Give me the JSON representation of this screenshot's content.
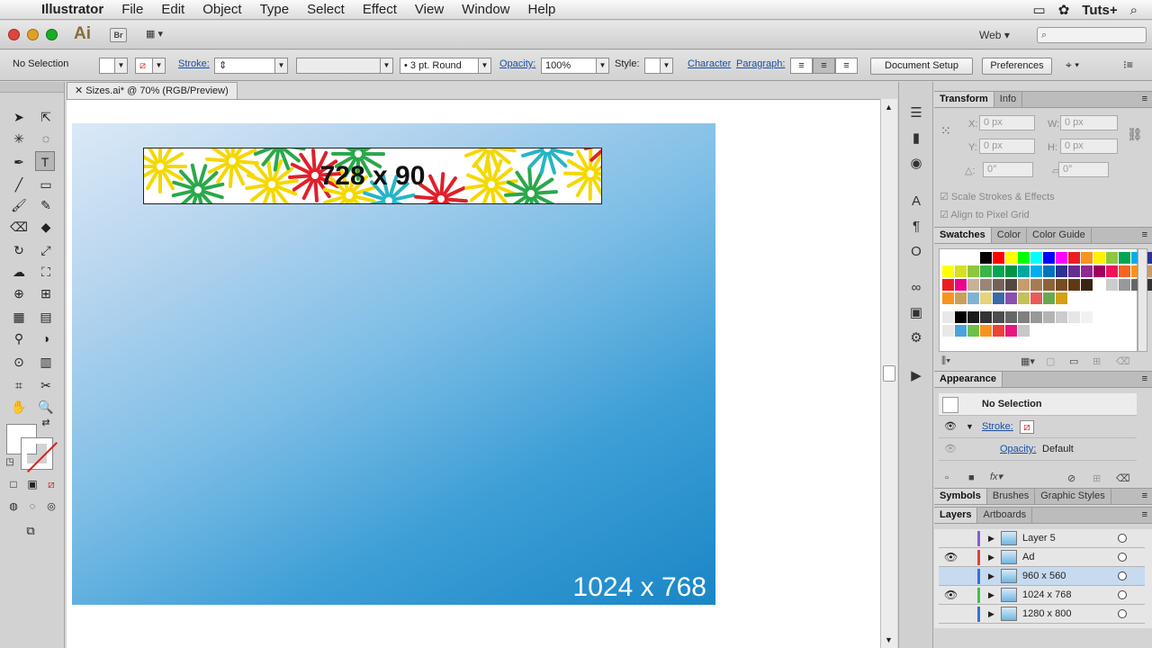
{
  "menubar": {
    "app_name": "Illustrator",
    "items": [
      "File",
      "Edit",
      "Object",
      "Type",
      "Select",
      "Effect",
      "View",
      "Window",
      "Help"
    ],
    "right_label": "Tuts+"
  },
  "appbar": {
    "logo": "Ai",
    "bridge_label": "Br",
    "workspace": "Web",
    "workspace_arrow": "▾"
  },
  "control": {
    "selection": "No Selection",
    "stroke_label": "Stroke:",
    "brush": "3 pt. Round",
    "opacity_label": "Opacity:",
    "opacity_value": "100%",
    "style_label": "Style:",
    "character_link": "Character",
    "paragraph_link": "Paragraph:",
    "document_setup": "Document Setup",
    "preferences": "Preferences"
  },
  "document": {
    "tab_title": "Sizes.ai* @ 70% (RGB/Preview)",
    "banner_label": "728 x 90",
    "artboard_label": "1024 x 768"
  },
  "transform_panel": {
    "tabs": [
      "Transform",
      "Info"
    ],
    "x_label": "X:",
    "x_value": "0 px",
    "y_label": "Y:",
    "y_value": "0 px",
    "w_label": "W:",
    "w_value": "0 px",
    "h_label": "H:",
    "h_value": "0 px",
    "angle_value": "0°",
    "shear_value": "0°",
    "scale_strokes": "Scale Strokes & Effects",
    "align_pixel": "Align to Pixel Grid"
  },
  "swatches_panel": {
    "tabs": [
      "Swatches",
      "Color",
      "Color Guide"
    ]
  },
  "appearance_panel": {
    "title": "Appearance",
    "no_selection": "No Selection",
    "stroke_label": "Stroke:",
    "opacity_label": "Opacity:",
    "opacity_value": "Default"
  },
  "symbols_panel": {
    "tabs": [
      "Symbols",
      "Brushes",
      "Graphic Styles"
    ]
  },
  "layers_panel": {
    "tabs": [
      "Layers",
      "Artboards"
    ],
    "layers": [
      {
        "name": "Layer 5",
        "color": "#8a5cd6",
        "visible": false
      },
      {
        "name": "Ad",
        "color": "#e04040",
        "visible": true
      },
      {
        "name": "960 x 560",
        "color": "#3a6fd8",
        "visible": false
      },
      {
        "name": "1024 x 768",
        "color": "#3ec24a",
        "visible": true
      },
      {
        "name": "1280 x 800",
        "color": "#3a6fd8",
        "visible": false
      }
    ]
  },
  "colors": {
    "artboard_gradient_start": "#dbe9f7",
    "artboard_gradient_end": "#1a86c6",
    "selected_layer": "#c6daf0"
  }
}
